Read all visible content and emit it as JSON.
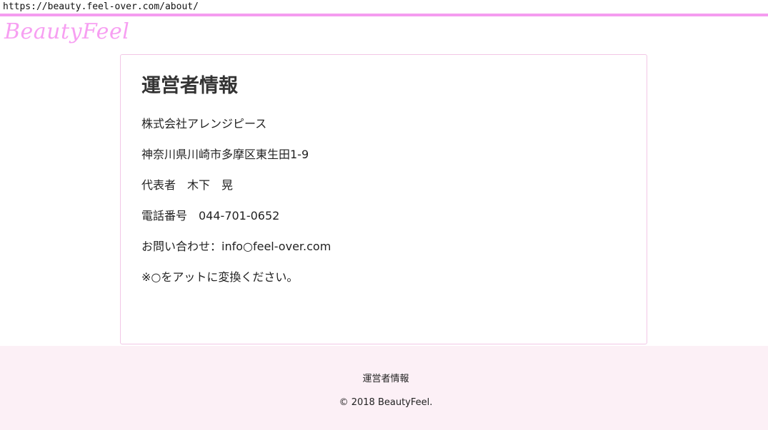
{
  "browser": {
    "url": "https://beauty.feel-over.com/about/"
  },
  "header": {
    "logo": "BeautyFeel",
    "accent_color": "#f59cf0"
  },
  "main": {
    "title": "運営者情報",
    "lines": [
      "株式会社アレンジピース",
      "神奈川県川崎市多摩区東生田1-9",
      "代表者　木下　晃",
      "電話番号　044-701-0652",
      "お問い合わせ：info○feel-over.com",
      "※○をアットに変換ください。"
    ]
  },
  "footer": {
    "link": "運営者情報",
    "copyright": "© 2018 BeautyFeel.",
    "background": "#fcf0f6"
  }
}
